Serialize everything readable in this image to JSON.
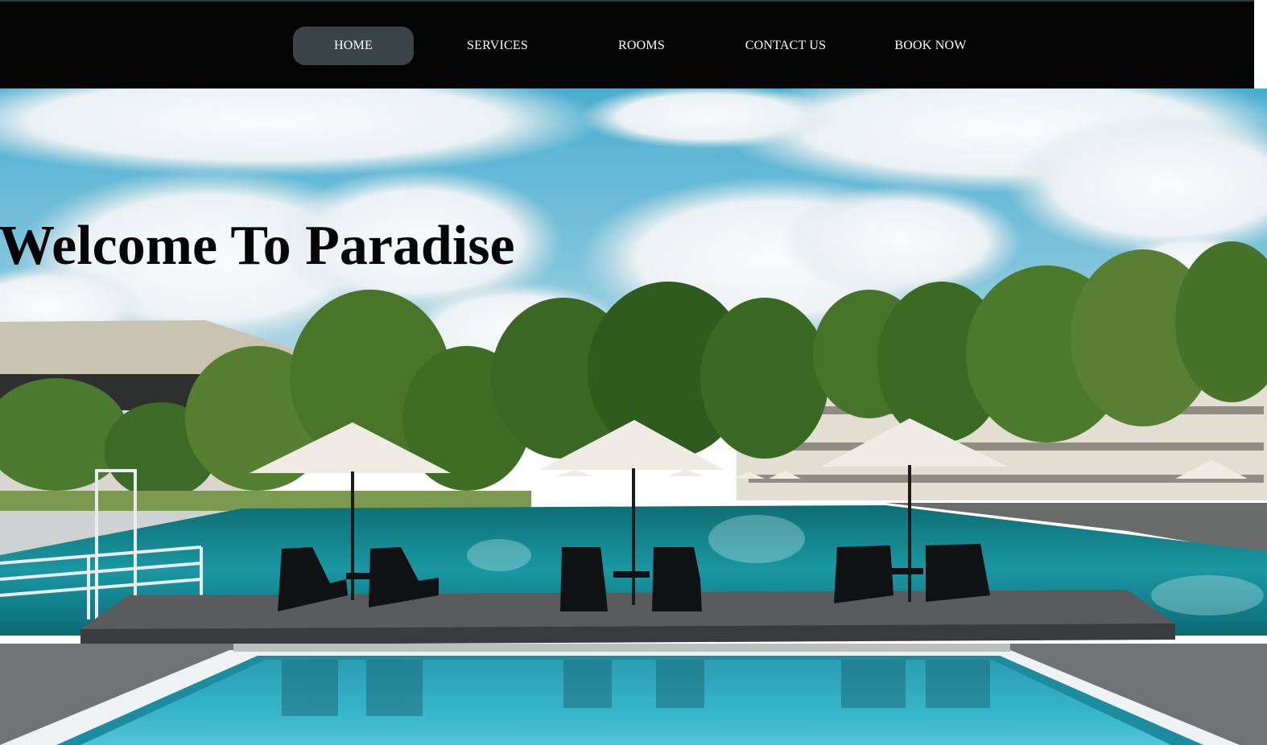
{
  "nav": {
    "items": [
      {
        "label": "HOME",
        "active": true
      },
      {
        "label": "SERVICES",
        "active": false
      },
      {
        "label": "ROOMS",
        "active": false
      },
      {
        "label": "CONTACT US",
        "active": false
      },
      {
        "label": "BOOK NOW",
        "active": false
      }
    ]
  },
  "hero": {
    "title": "Welcome To Paradise",
    "image_description_icon": "resort-pool-photo"
  },
  "colors": {
    "navbar_bg": "#040405",
    "active_pill": "#3a4346",
    "nav_text": "#ffffff",
    "title_text": "#050505"
  }
}
